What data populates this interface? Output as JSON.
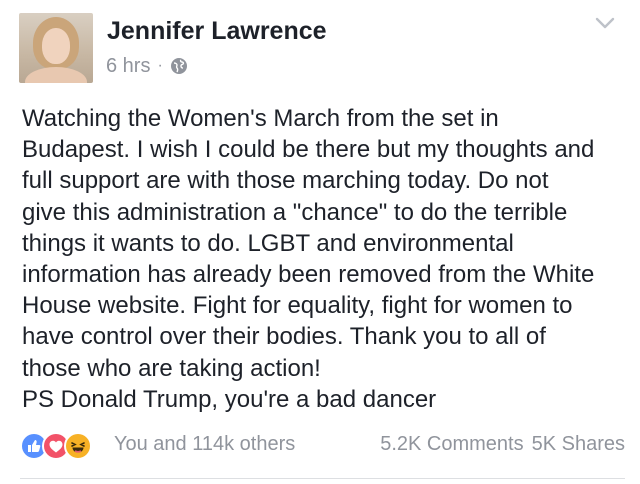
{
  "author": {
    "name": "Jennifer Lawrence",
    "timestamp": "6 hrs",
    "separator": "·",
    "privacy_icon": "globe-icon"
  },
  "post": {
    "lines": [
      "Watching the Women's March from the set in",
      "Budapest. I wish I could be there but my thoughts and",
      "full support are with those marching today. Do not",
      "give this administration a \"chance\" to do the terrible",
      "things it wants to do. LGBT and environmental",
      "information has already been removed from the White",
      "House website. Fight for equality, fight for women to",
      "have control over their bodies. Thank you to all of",
      "those who are taking action!",
      "PS Donald Trump, you're a bad dancer"
    ]
  },
  "footer": {
    "reactions": [
      "like-icon",
      "love-icon",
      "haha-icon"
    ],
    "reaction_summary": "You and 114k others",
    "comments": "5.2K Comments",
    "shares": "5K Shares"
  },
  "colors": {
    "text": "#1d2129",
    "meta": "#90949c",
    "like": "#5890ff",
    "love": "#f25268",
    "haha": "#f7b125"
  }
}
